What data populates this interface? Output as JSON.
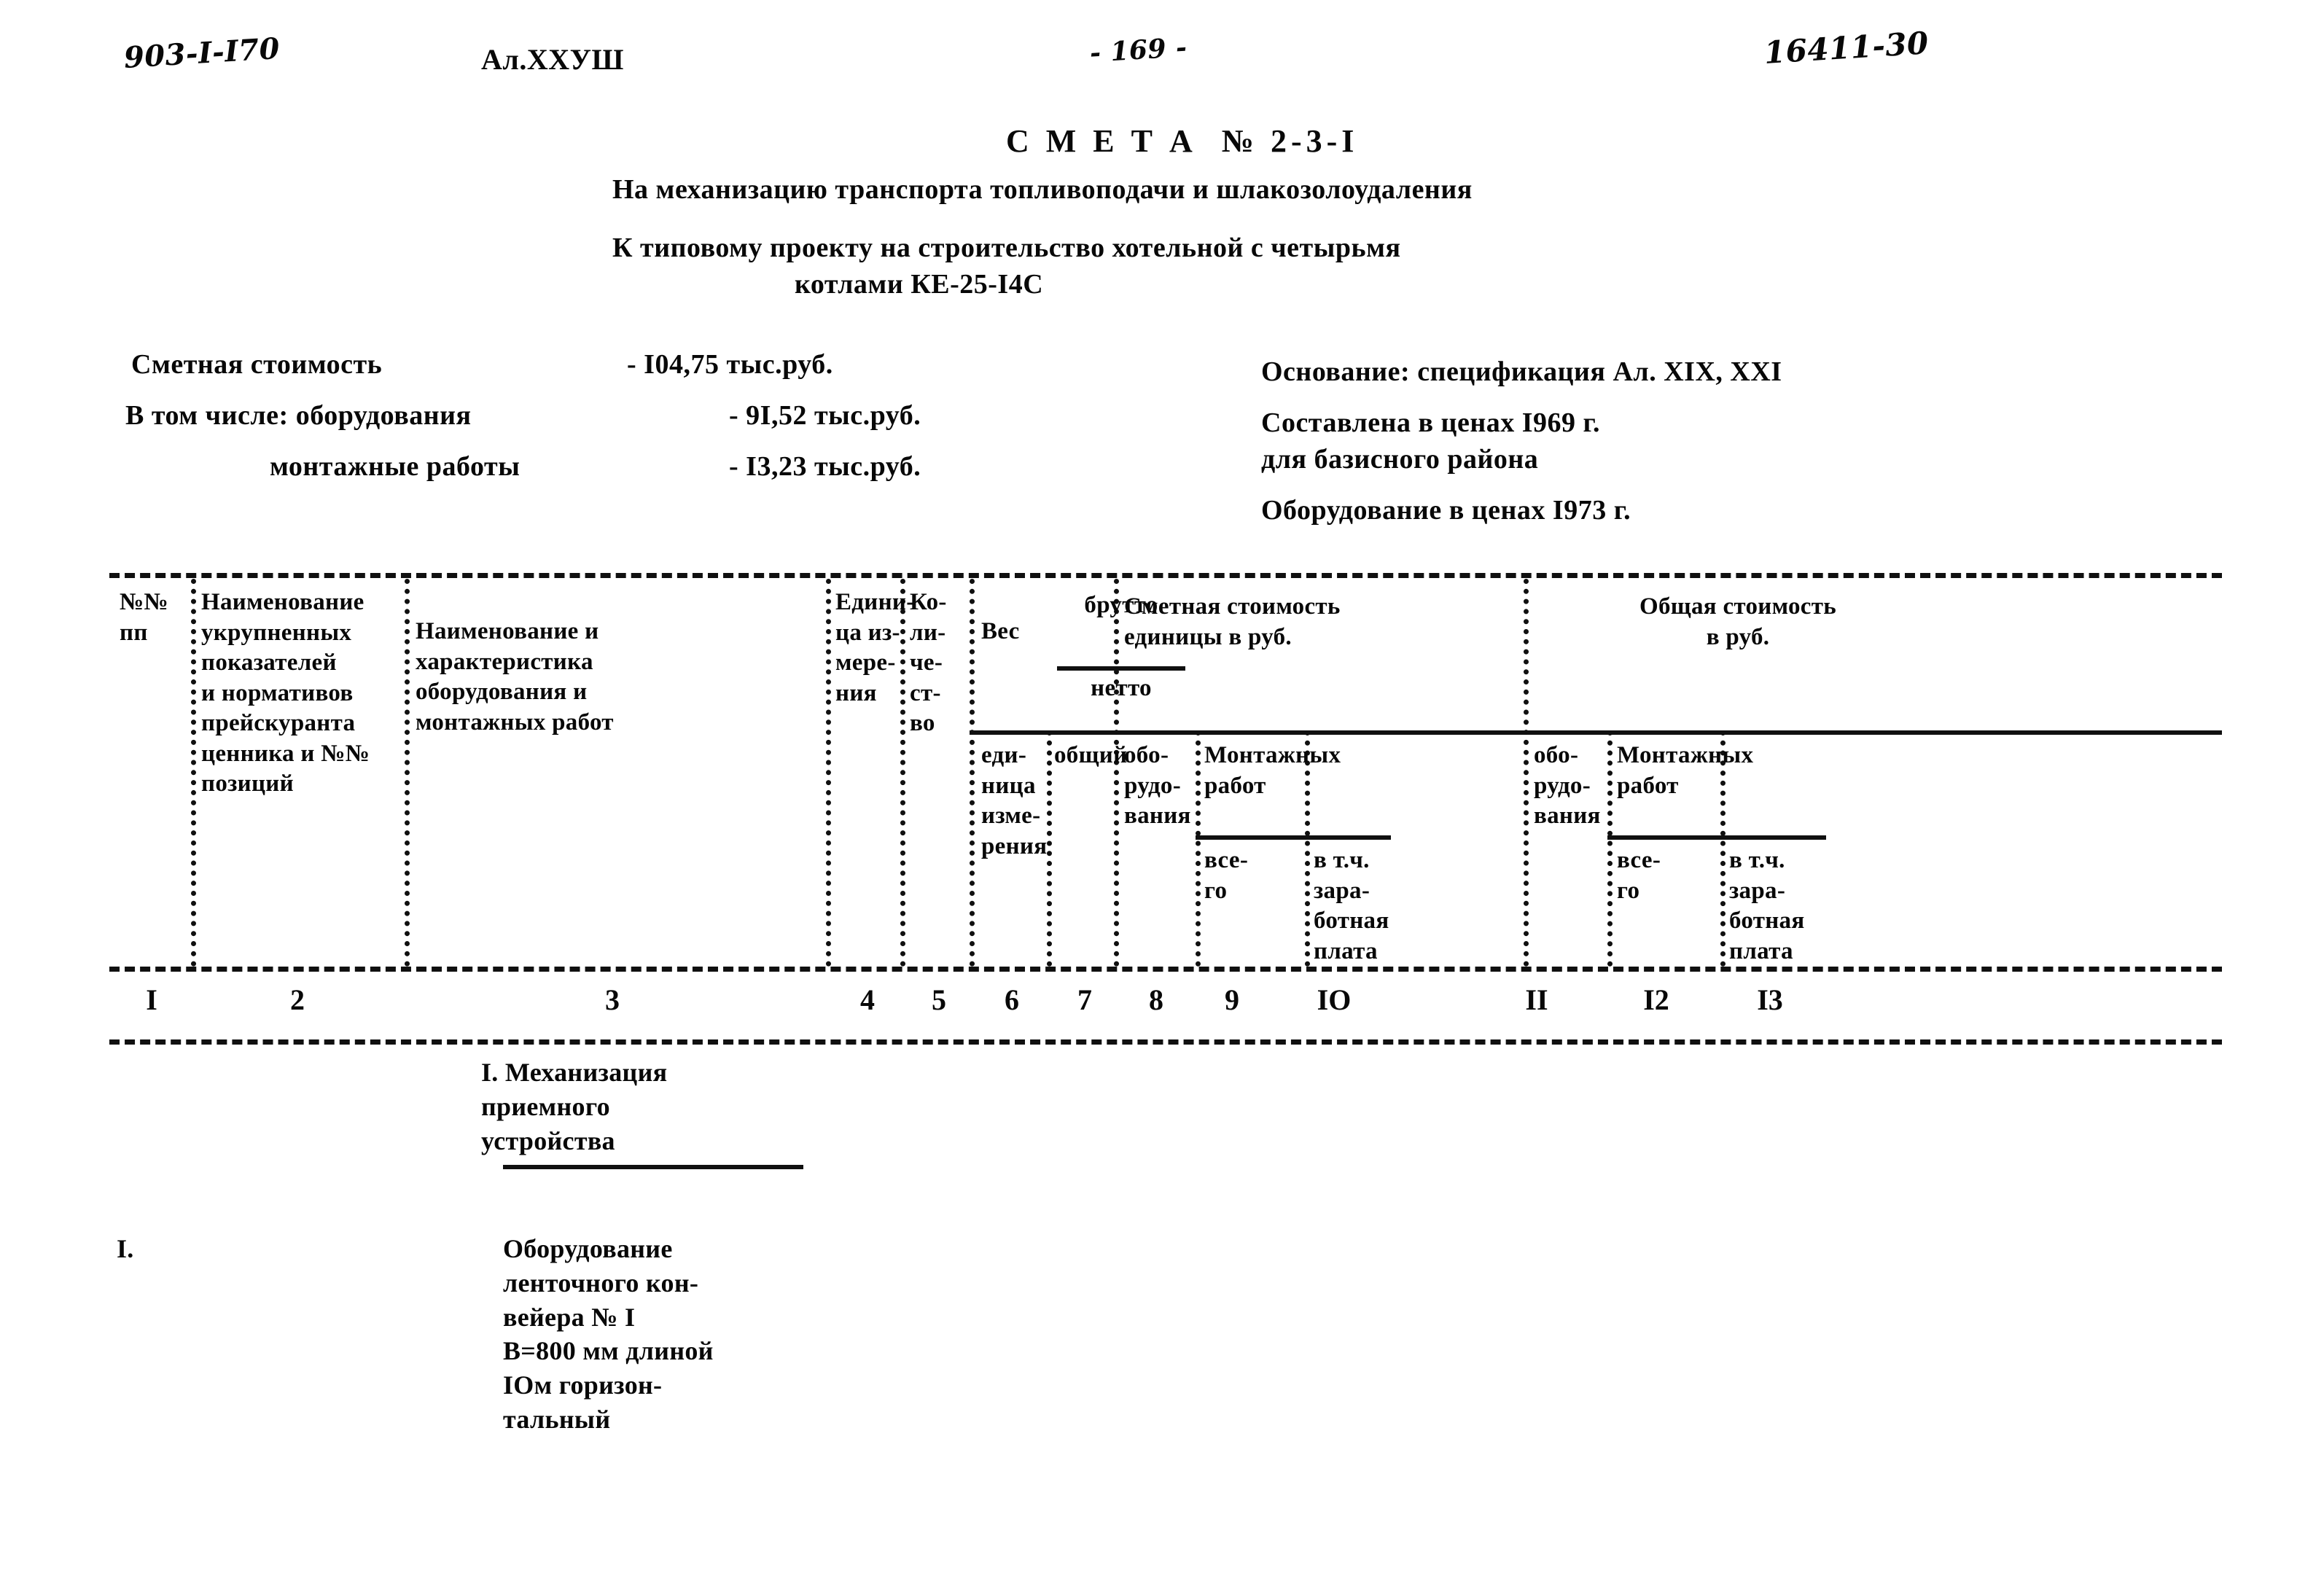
{
  "header": {
    "doc_code": "903-I-I70",
    "album_code": "Ал.ХХУШ",
    "page_number": "- 169 -",
    "stamp_number": "16411-30"
  },
  "titles": {
    "smeta": "С М Е Т А  № 2-3-I",
    "line1": "На механизацию транспорта топливоподачи и шлакозолоудаления",
    "line2": "К типовому проекту на строительство хотельной с четырьмя",
    "line3": "котлами КЕ-25-I4С"
  },
  "cost_summary": [
    {
      "label": "Сметная стоимость",
      "value": "- I04,75 тыс.руб."
    },
    {
      "label": "В том числе: оборудования",
      "value": "- 9I,52 тыс.руб."
    },
    {
      "label": "монтажные работы",
      "value": "- I3,23 тыс.руб."
    }
  ],
  "basis_info": [
    "Основание: спецификация Ал. XIX, XXI",
    "Составлена в ценах I969 г.",
    "для базисного района",
    "Оборудование в ценах I973 г."
  ],
  "table": {
    "headers": {
      "col1": "№№\nпп",
      "col2": "Наименование\nукрупненных\nпоказателей\nи нормативов\nпрейскуранта\nценника и №№\nпозиций",
      "col3": "Наименование и\nхарактеристика\nоборудования и\nмонтажных работ",
      "col4": "Едини-\nца из-\nмере-\nния",
      "col5": "Ко-\nли-\nче-\nст-\nво",
      "weight_label": "Вес",
      "weight_brutto": "брутто",
      "weight_netto": "нетто",
      "col6": "еди-\nница\nизме-\nрения",
      "col7": "общий",
      "group_unit_cost": "Сметная стоимость\nединицы в руб.",
      "col8": "обо-\nрудо-\nвания",
      "montage_1": "Монтажных\nработ",
      "col9": "все-\nго",
      "col10": "в т.ч.\nзара-\nботная\nплата",
      "group_total_cost": "Общая стоимость\nв руб.",
      "col11": "обо-\nрудо-\nвания",
      "montage_2": "Монтажных\nработ",
      "col12": "все-\nго",
      "col13": "в т.ч.\nзара-\nботная\nплата"
    },
    "column_numbers": [
      "I",
      "2",
      "3",
      "4",
      "5",
      "6",
      "7",
      "8",
      "9",
      "IO",
      "II",
      "I2",
      "I3"
    ]
  },
  "body": {
    "section_heading": "I. Механизация\n   приемного\n  устройства",
    "row1_number": "I.",
    "row1_description": "Оборудование\nленточного кон-\nвейера № I\nB=800 мм длиной\nIOм горизон-\nтальный"
  }
}
